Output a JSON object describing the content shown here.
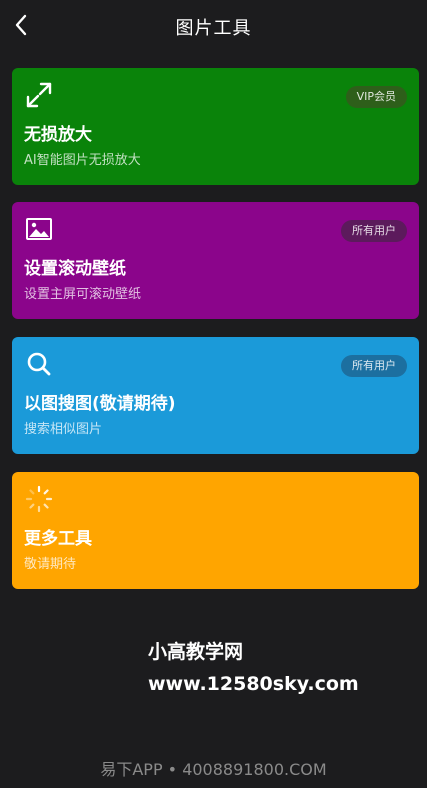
{
  "header": {
    "title": "图片工具",
    "back_icon": "chevron-left-icon"
  },
  "cards": [
    {
      "title": "无损放大",
      "subtitle": "AI智能图片无损放大",
      "badge": "VIP会员",
      "icon": "expand-arrows-icon",
      "color": "#0a830a"
    },
    {
      "title": "设置滚动壁纸",
      "subtitle": "设置主屏可滚动壁纸",
      "badge": "所有用户",
      "icon": "image-icon",
      "color": "#8b058b"
    },
    {
      "title": "以图搜图(敬请期待)",
      "subtitle": "搜索相似图片",
      "badge": "所有用户",
      "icon": "search-icon",
      "color": "#1b9ad9"
    },
    {
      "title": "更多工具",
      "subtitle": "敬请期待",
      "icon": "loading-spinner-icon",
      "color": "#ffa500"
    }
  ],
  "watermark": {
    "line1": "小高教学网",
    "line2": "www.12580sky.com"
  },
  "footer": {
    "text": "易下APP • 4008891800.COM"
  }
}
